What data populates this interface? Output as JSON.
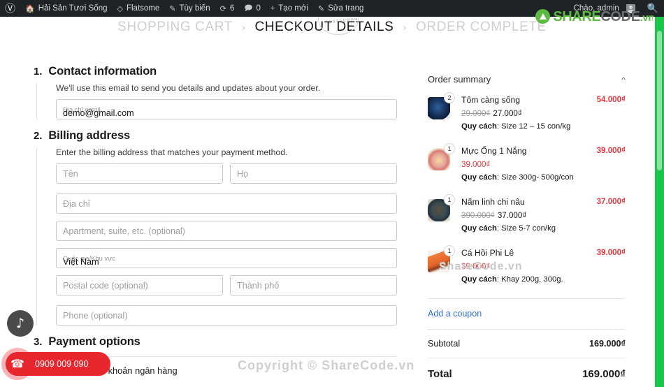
{
  "adminbar": {
    "logo_icon": "wordpress-icon",
    "items": [
      {
        "icon": "home-icon",
        "label": "Hải Sản Tươi Sống"
      },
      {
        "icon": "diamond-icon",
        "label": "Flatsome"
      },
      {
        "icon": "pencil-icon",
        "label": "Tùy biến"
      },
      {
        "icon": "refresh-icon",
        "label": "6"
      },
      {
        "icon": "comment-icon",
        "label": "0"
      },
      {
        "icon": "plus-icon",
        "label": "Tạo mới"
      },
      {
        "icon": "edit-icon",
        "label": "Sửa trang"
      }
    ],
    "greeting": "Chào, admin",
    "search_icon": "search-icon"
  },
  "brand": {
    "part1": "SHARE",
    "part2": "CODE",
    "part3": ".vn",
    "green": "#5bba3f",
    "gray": "#6d6e71"
  },
  "seal_text": "RESTAURANT",
  "breadcrumb": {
    "steps": [
      {
        "label": "SHOPPING CART",
        "active": false
      },
      {
        "label": "CHECKOUT DETAILS",
        "active": true
      },
      {
        "label": "ORDER COMPLETE",
        "active": false
      }
    ],
    "separator": "›"
  },
  "contact": {
    "number": "1.",
    "title": "Contact information",
    "description": "We'll use this email to send you details and updates about your order.",
    "email_label": "Địa chỉ email",
    "email_value": "demo@gmail.com"
  },
  "billing": {
    "number": "2.",
    "title": "Billing address",
    "description": "Enter the billing address that matches your payment method.",
    "first_name_placeholder": "Tên",
    "last_name_placeholder": "Họ",
    "address_placeholder": "Địa chỉ",
    "apartment_placeholder": "Apartment, suite, etc. (optional)",
    "country_label": "Quốc gia/Khu vực",
    "country_value": "Việt Nam",
    "postal_placeholder": "Postal code (optional)",
    "city_placeholder": "Thành phố",
    "phone_placeholder": "Phone (optional)"
  },
  "payment": {
    "number": "3.",
    "title": "Payment options",
    "options": [
      {
        "label": "Chuyển khoản ngân hàng",
        "selected": false
      }
    ]
  },
  "order_summary": {
    "title": "Order summary",
    "collapse_icon": "chevron-up-icon",
    "items": [
      {
        "qty": "2",
        "name": "Tôm càng sống",
        "old_price": "29.000₫",
        "new_price": "27.000₫",
        "new_price_red": false,
        "meta_label": "Quy cách",
        "meta_value": ": Size 12 – 15 con/kg",
        "line_total": "54.000₫",
        "thumb_class": "th1"
      },
      {
        "qty": "1",
        "name": "Mực Ống 1 Nắng",
        "old_price": "",
        "new_price": "39.000₫",
        "new_price_red": true,
        "meta_label": "Quy cách",
        "meta_value": ": Size 300g- 500g/con",
        "line_total": "39.000₫",
        "thumb_class": "th2"
      },
      {
        "qty": "1",
        "name": "Nấm linh chi nâu",
        "old_price": "390.000₫",
        "new_price": "37.000₫",
        "new_price_red": false,
        "meta_label": "Quy cách",
        "meta_value": ": Size 5-7 con/kg",
        "line_total": "37.000₫",
        "thumb_class": "th3"
      },
      {
        "qty": "1",
        "name": "Cá Hồi Phi Lê",
        "old_price": "",
        "new_price": "39.000₫",
        "new_price_red": true,
        "meta_label": "Quy cách",
        "meta_value": ": Khay 200g, 300g.",
        "line_total": "39.000₫",
        "thumb_class": "th4"
      }
    ],
    "coupon_link": "Add a coupon",
    "subtotal_label": "Subtotal",
    "subtotal_value": "169.000₫",
    "total_label": "Total",
    "total_value": "169.000₫"
  },
  "widgets": {
    "tiktok_icon": "tiktok-icon",
    "phone_icon": "phone-icon",
    "phone_number": "0909 009 090"
  },
  "watermarks": {
    "bottom": "Copyright © ShareCode.vn",
    "item": "ShareCode.vn"
  }
}
